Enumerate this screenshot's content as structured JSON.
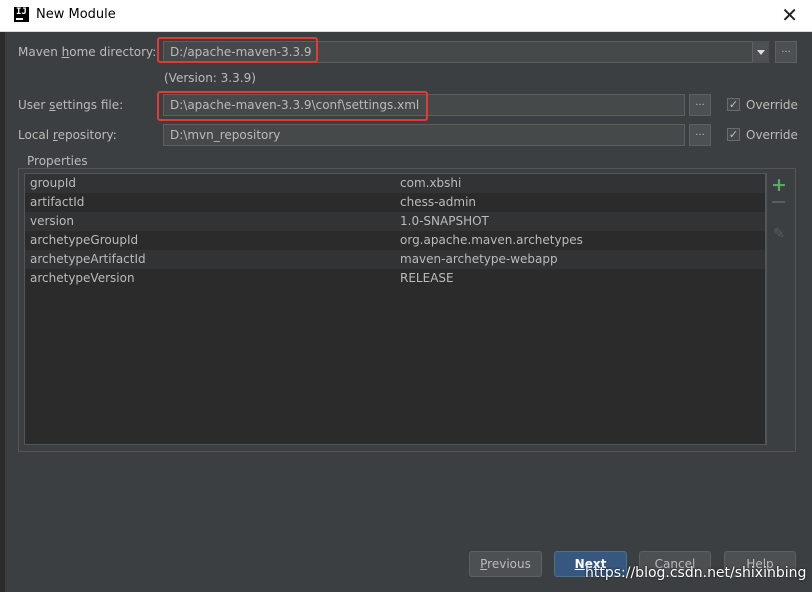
{
  "window": {
    "title": "New Module"
  },
  "maven": {
    "home_label_pre": "Maven ",
    "home_label_h": "h",
    "home_label_post": "ome directory:",
    "home_value": "D:/apache-maven-3.3.9",
    "version": "(Version: 3.3.9)",
    "settings_label_pre": "User ",
    "settings_label_s": "s",
    "settings_label_post": "ettings file:",
    "settings_value": "D:\\apache-maven-3.3.9\\conf\\settings.xml",
    "repo_label_pre": "Local ",
    "repo_label_r": "r",
    "repo_label_post": "epository:",
    "repo_value": "D:\\mvn_repository",
    "override_label": "Override",
    "browse_label": "...",
    "override_settings_checked": true,
    "override_repo_checked": true
  },
  "properties": {
    "title": "Properties",
    "rows": [
      {
        "key": "groupId",
        "value": "com.xbshi"
      },
      {
        "key": "artifactId",
        "value": "chess-admin"
      },
      {
        "key": "version",
        "value": "1.0-SNAPSHOT"
      },
      {
        "key": "archetypeGroupId",
        "value": "org.apache.maven.archetypes"
      },
      {
        "key": "archetypeArtifactId",
        "value": "maven-archetype-webapp"
      },
      {
        "key": "archetypeVersion",
        "value": "RELEASE"
      }
    ],
    "toolbar_icons": [
      "plus-icon",
      "minus-icon",
      "pencil-icon"
    ]
  },
  "buttons": {
    "previous_u": "P",
    "previous_rest": "revious",
    "next_u": "N",
    "next_rest": "ext",
    "cancel": "Cancel",
    "help": "Help"
  },
  "colors": {
    "highlight": "#e53935",
    "primary_button": "#365880",
    "add_icon": "#59a869"
  },
  "watermark": "https://blog.csdn.net/shixinbing"
}
